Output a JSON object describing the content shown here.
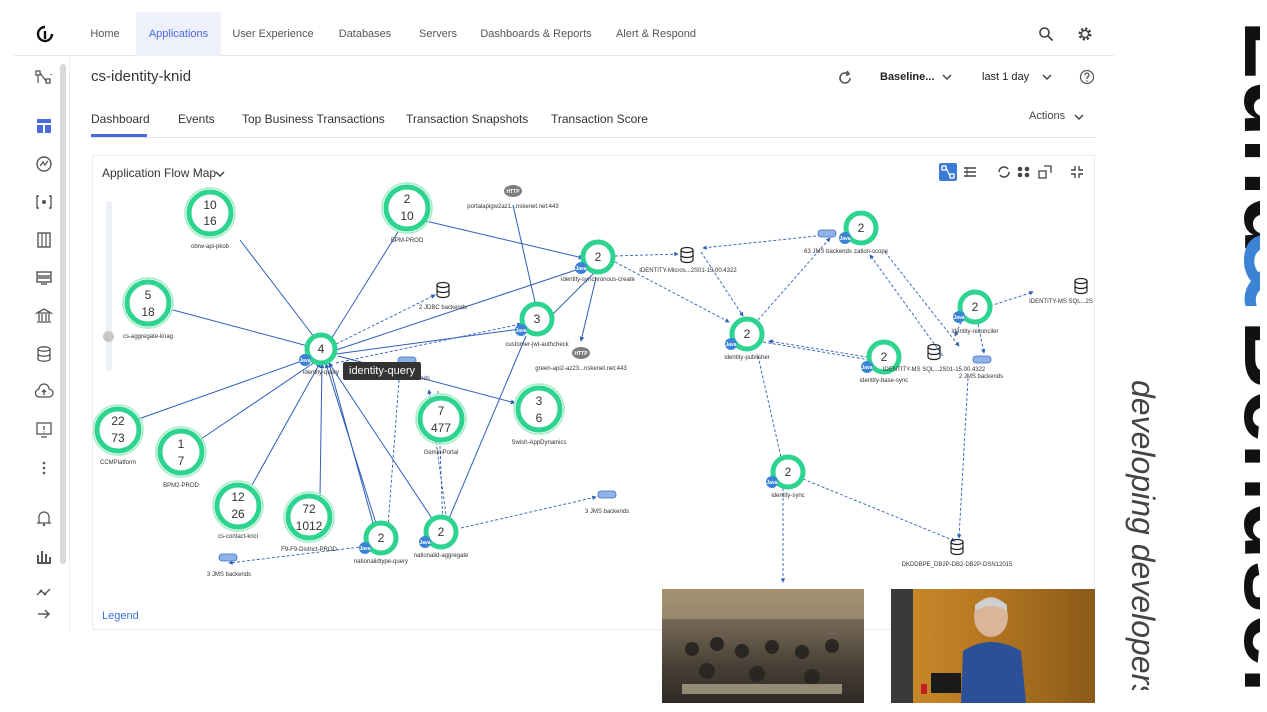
{
  "nav": {
    "items": [
      "Home",
      "Applications",
      "User Experience",
      "Databases",
      "Servers",
      "Dashboards & Reports",
      "Alert & Respond"
    ],
    "active": "Applications"
  },
  "header": {
    "title": "cs-identity-knid",
    "baseline": "Baseline...",
    "time_range": "last 1 day"
  },
  "tabs": [
    "Dashboard",
    "Events",
    "Top Business Transactions",
    "Transaction Snapshots",
    "Transaction Score"
  ],
  "actions_label": "Actions",
  "panel": {
    "title": "Application Flow Map",
    "legend": "Legend",
    "tooltip": "identity-query"
  },
  "nodes": [
    {
      "id": "obrw",
      "l1": "10",
      "l2": "16",
      "label": "obrw-api-pkob"
    },
    {
      "id": "bpm",
      "l1": "2",
      "l2": "10",
      "label": "BPM-PROD"
    },
    {
      "id": "agg",
      "l1": "5",
      "l2": "18",
      "label": "cs-aggregate-knag"
    },
    {
      "id": "query",
      "l1": "4",
      "l2": "",
      "label": "identity-query"
    },
    {
      "id": "sync_create",
      "l1": "2",
      "l2": "",
      "label": "identity-synchronous-create"
    },
    {
      "id": "jwt",
      "l1": "3",
      "l2": "",
      "label": "customer-jwt-authcheck"
    },
    {
      "id": "ccm",
      "l1": "22",
      "l2": "73",
      "label": "CCMPlatform"
    },
    {
      "id": "bpm2",
      "l1": "1",
      "l2": "7",
      "label": "BPM2-PROD"
    },
    {
      "id": "gemini",
      "l1": "7",
      "l2": "477",
      "label": "GeminiPortal"
    },
    {
      "id": "swish",
      "l1": "3",
      "l2": "6",
      "label": "Swish-AppDynamics"
    },
    {
      "id": "contact",
      "l1": "12",
      "l2": "26",
      "label": "cs-contact-knci"
    },
    {
      "id": "f9",
      "l1": "72",
      "l2": "1012",
      "label": "F9-F9-District-PROD"
    },
    {
      "id": "ntquery",
      "l1": "2",
      "l2": "",
      "label": "nationalidtype-query"
    },
    {
      "id": "ntagg",
      "l1": "2",
      "l2": "",
      "label": "nationalid-aggregate"
    },
    {
      "id": "zation",
      "l1": "2",
      "l2": "",
      "label": "zation-scope"
    },
    {
      "id": "publisher",
      "l1": "2",
      "l2": "",
      "label": "identity-publisher"
    },
    {
      "id": "reconciler",
      "l1": "2",
      "l2": "",
      "label": "identity-reconciler"
    },
    {
      "id": "basesync",
      "l1": "2",
      "l2": "",
      "label": "identity-base-sync"
    },
    {
      "id": "isync",
      "l1": "2",
      "l2": "",
      "label": "identity-sync"
    }
  ],
  "backends": {
    "http1": "portalapigw2az1...nskenet.net:443",
    "http2": "green-api2-az23...nskenet.net:443",
    "jdbc": "2 JDBC backends",
    "identity_micro": "IDENTITY-Micros...2S01-15.00.4322",
    "jms_top": "63 JMS backends",
    "identity_ms_right": "IDENTITY-MS SQL...2S",
    "identity_ms_mid": "IDENTITY-MS SQL...2S01-15.00.4322",
    "jms_2": "2 JMS backends",
    "jms_3_mid": "3 JMS backends",
    "jms_3_left": "3 JMS backends",
    "dkddbpe": "DKDDBPE_DB2P-DB2-DB2P-DSN12015",
    "nds_partial": "nds",
    "http_badge": "HTTP",
    "java_badge": "Java"
  },
  "brand": {
    "name_part1": "Lund",
    "ampersand": "&",
    "name_part2": "Bendsen",
    "tagline": "developing developers"
  },
  "colors": {
    "accent": "#4a6ae0",
    "node_green": "#2dd48f",
    "edge_blue": "#2f5fb8",
    "brand_blue": "#3c83d6"
  }
}
